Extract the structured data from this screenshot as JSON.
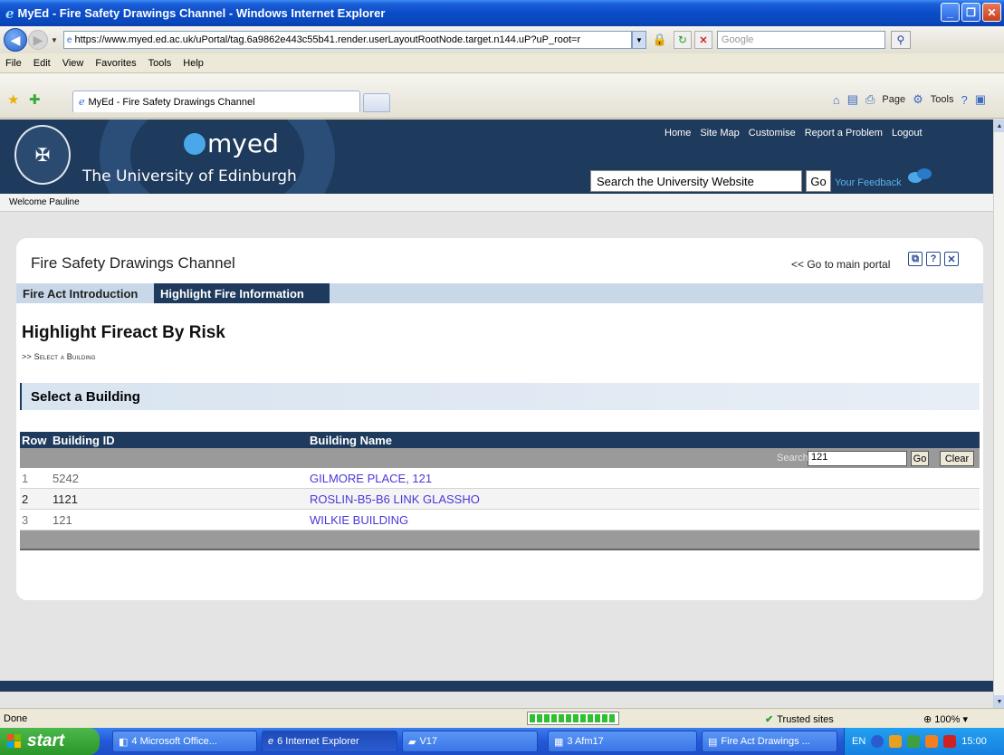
{
  "window": {
    "title": "MyEd - Fire Safety Drawings Channel - Windows Internet Explorer",
    "buttons": [
      "minimize",
      "maximize",
      "close"
    ]
  },
  "address_bar": {
    "url": "https://www.myed.ed.ac.uk/uPortal/tag.6a9862e443c55b41.render.userLayoutRootNode.target.n144.uP?uP_root=r",
    "search_placeholder": "Google"
  },
  "menu": [
    "File",
    "Edit",
    "View",
    "Favorites",
    "Tools",
    "Help"
  ],
  "tab": {
    "label": "MyEd - Fire Safety Drawings Channel"
  },
  "command_bar": {
    "page": "Page",
    "tools": "Tools"
  },
  "site": {
    "brand": "myed",
    "university": "The University of Edinburgh",
    "top_links": [
      "Home",
      "Site Map",
      "Customise",
      "Report a Problem",
      "Logout"
    ],
    "search_value": "Search the University Website",
    "search_go": "Go",
    "feedback": "Your Feedback",
    "welcome": "Welcome Pauline"
  },
  "channel": {
    "title": "Fire Safety Drawings Channel",
    "go_main": "<< Go to main portal",
    "tabs": [
      "Fire Act Introduction",
      "Highlight Fire Information"
    ],
    "active_tab": "Highlight Fire Information",
    "heading": "Highlight Fireact By Risk",
    "breadcrumb": ">> Select a Building",
    "section_title": "Select a Building",
    "grid": {
      "headers": [
        "Row",
        "Building ID",
        "Building Name"
      ],
      "search_label": "Search:",
      "search_value": "121",
      "go_label": "Go",
      "clear_label": "Clear",
      "rows": [
        {
          "row": "1",
          "id": "5242",
          "name": "GILMORE PLACE, 121"
        },
        {
          "row": "2",
          "id": "1121",
          "name": "ROSLIN-B5-B6 LINK GLASSHO"
        },
        {
          "row": "3",
          "id": "121",
          "name": "WILKIE BUILDING"
        }
      ]
    }
  },
  "status_bar": {
    "status": "Done",
    "zone": "Trusted sites",
    "zoom": "100%"
  },
  "taskbar": {
    "start": "start",
    "items": [
      "4 Microsoft Office...",
      "6 Internet Explorer",
      "V17",
      "3 Afm17",
      "Fire Act Drawings ..."
    ],
    "lang": "EN",
    "clock": "15:00"
  }
}
